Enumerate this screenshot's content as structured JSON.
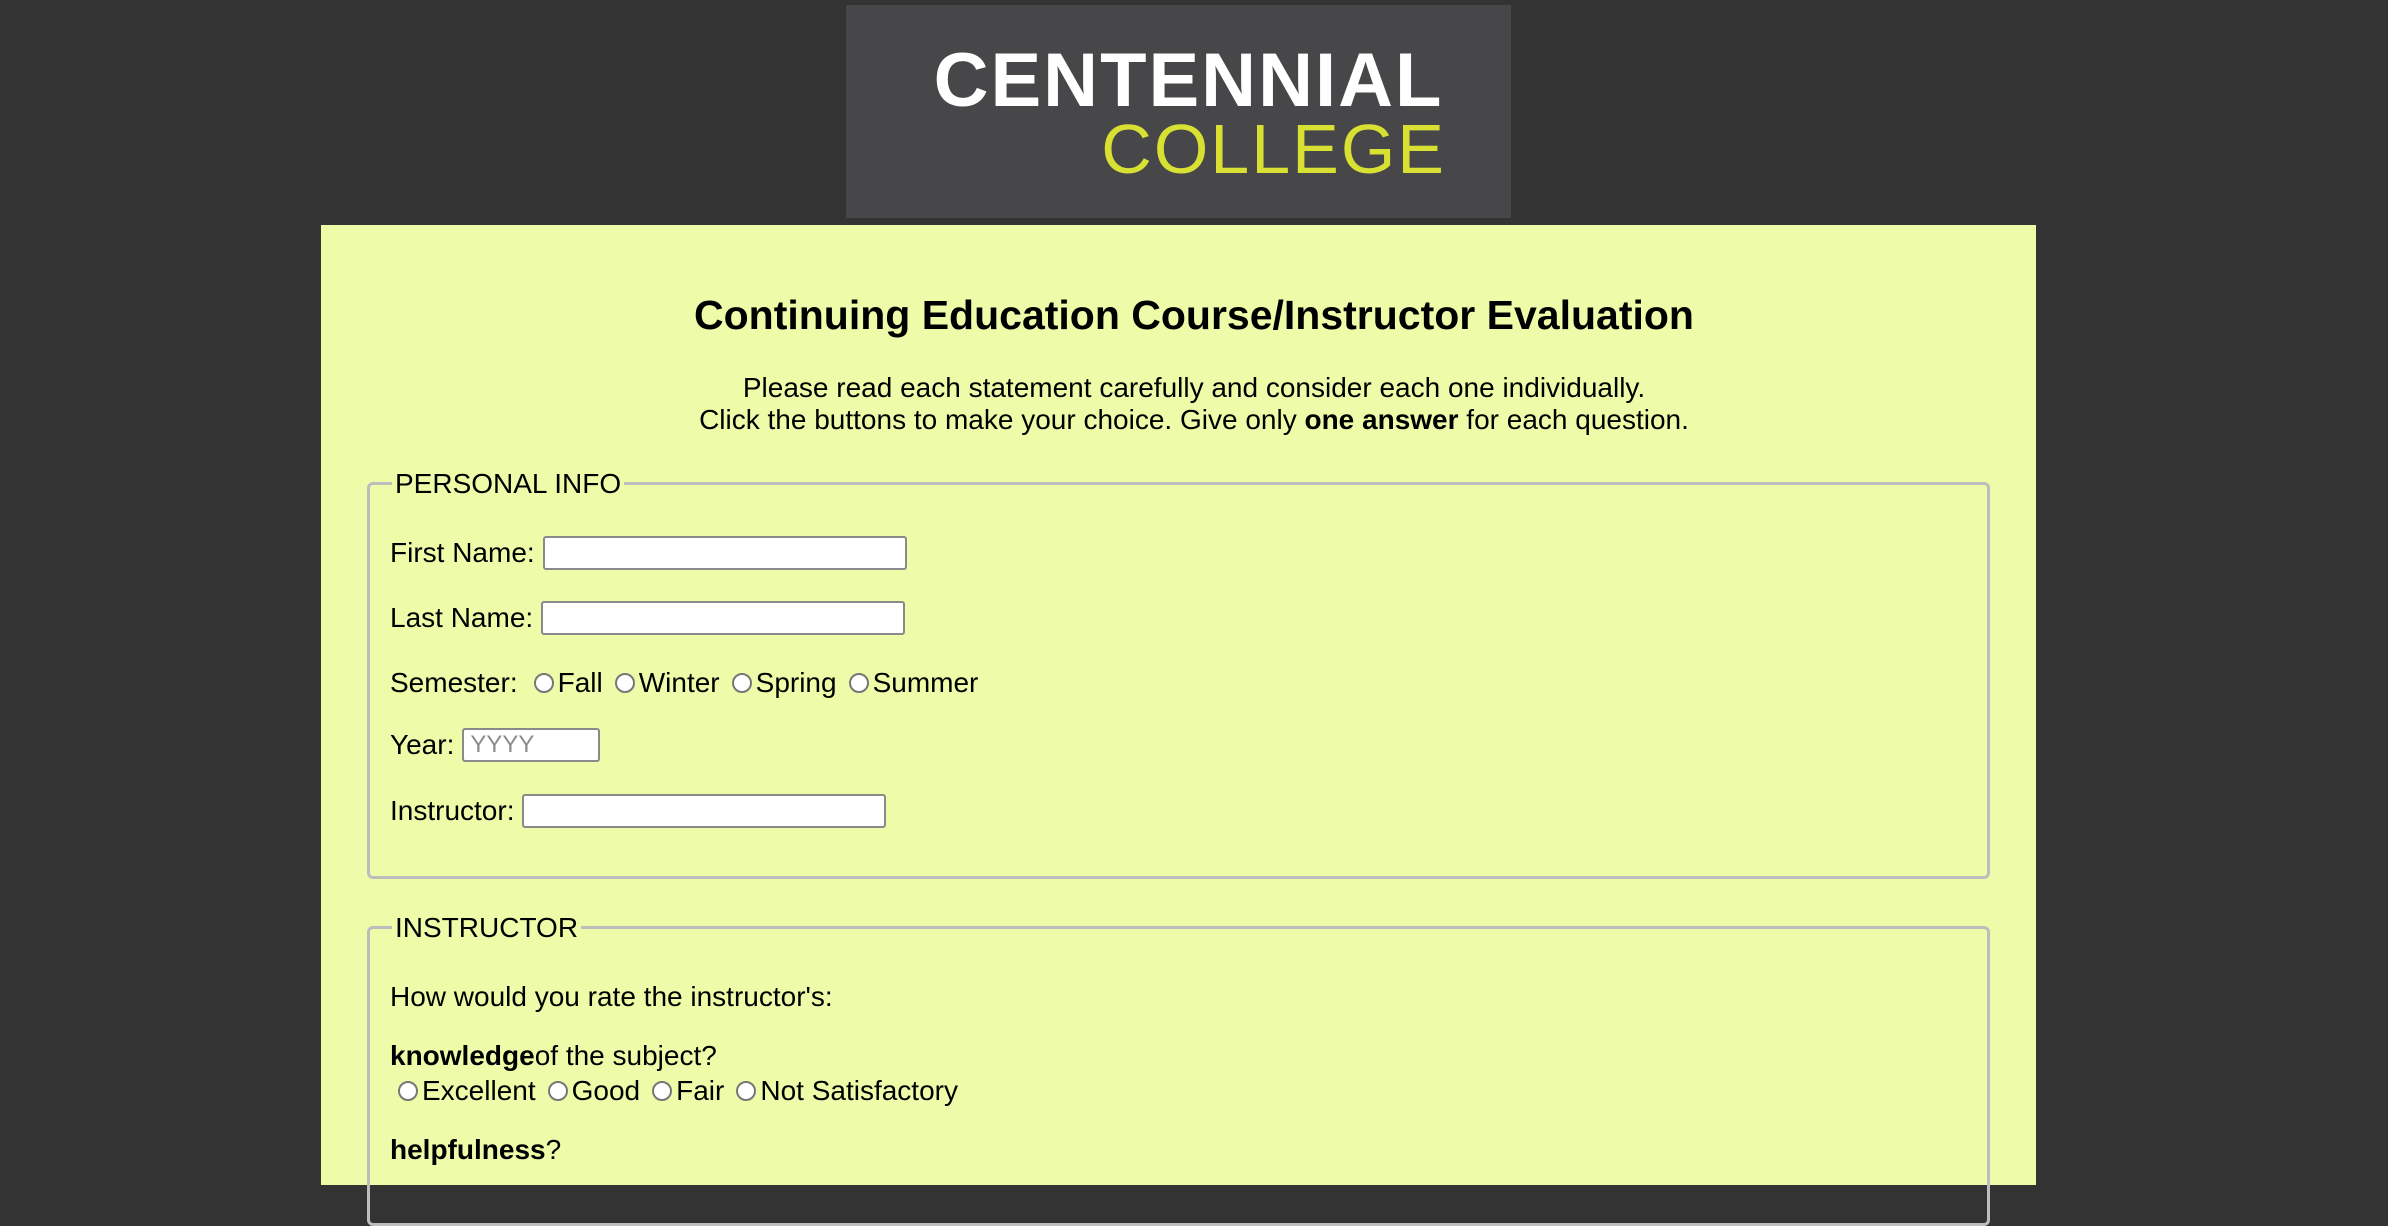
{
  "logo": {
    "line1": "CENTENNIAL",
    "line2": "COLLEGE"
  },
  "page_title": "Continuing Education Course/Instructor Evaluation",
  "intro": {
    "line1": "Please read each statement carefully and consider each one individually.",
    "line2_prefix": "Click the buttons to make your choice. Give only ",
    "line2_bold": "one answer",
    "line2_suffix": " for each question."
  },
  "personal": {
    "legend": "PERSONAL INFO",
    "first_name_label": "First Name:",
    "last_name_label": "Last Name:",
    "semester_label": "Semester:",
    "semester_options": [
      "Fall",
      "Winter",
      "Spring",
      "Summer"
    ],
    "year_label": "Year:",
    "year_placeholder": "YYYY",
    "instructor_label": "Instructor:"
  },
  "instructor": {
    "legend": "INSTRUCTOR",
    "question_intro": "How would you rate the instructor's:",
    "q1_bold": "knowledge",
    "q1_rest": " of the subject?",
    "rating_options": [
      "Excellent",
      "Good",
      "Fair",
      "Not Satisfactory"
    ],
    "q2_bold": "helpfulness",
    "q2_rest": "?"
  },
  "colors": {
    "background": "#333333",
    "panel": "#eefba8",
    "logo_box": "#474749",
    "logo_accent": "#d8e033"
  }
}
